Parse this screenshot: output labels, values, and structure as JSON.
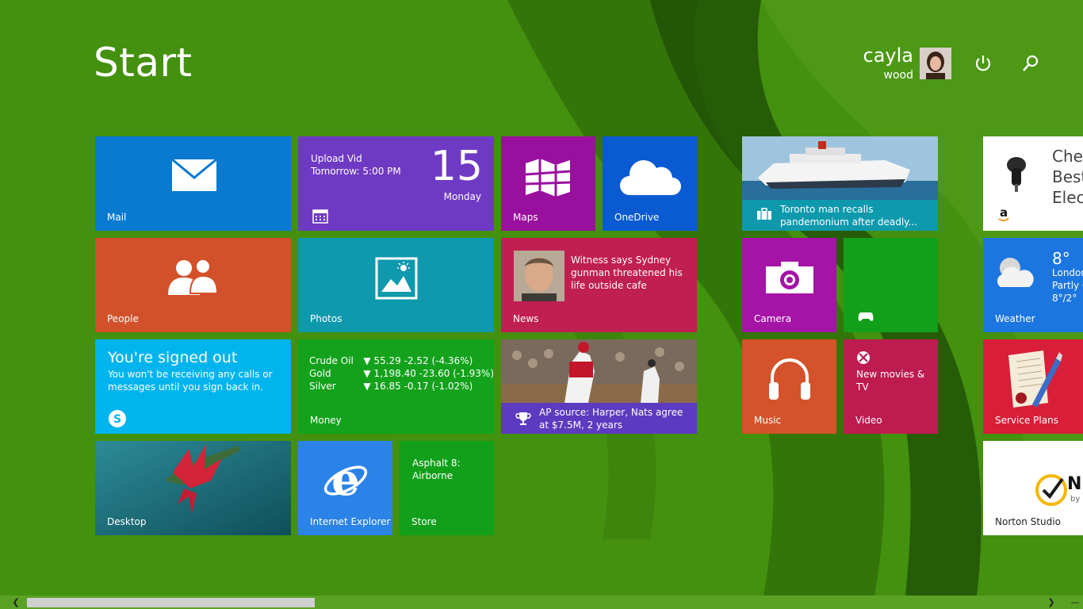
{
  "header": {
    "title": "Start",
    "user_first": "cayla",
    "user_last": "wood"
  },
  "tiles": {
    "mail": {
      "label": "Mail"
    },
    "calendar": {
      "event": "Upload Vid",
      "time": "Tomorrow: 5:00 PM",
      "day_num": "15",
      "day_name": "Monday"
    },
    "maps": {
      "label": "Maps"
    },
    "onedrive": {
      "label": "OneDrive"
    },
    "travel": {
      "headline": "Toronto man recalls pandemonium after deadly..."
    },
    "store_ad": {
      "text_line1": "Chec",
      "text_line2": "Best",
      "text_line3": "Elect"
    },
    "people": {
      "label": "People"
    },
    "photos": {
      "label": "Photos"
    },
    "news": {
      "headline": "Witness says Sydney gunman threatened his life outside cafe",
      "label": "News"
    },
    "camera": {
      "label": "Camera"
    },
    "weather": {
      "temp": "8°",
      "city": "London",
      "cond": "Partly C",
      "range": "8°/2°",
      "label": "Weather"
    },
    "skype": {
      "heading": "You're signed out",
      "body": "You won't be receiving any calls or messages until you sign back in."
    },
    "money": {
      "label": "Money",
      "rows": [
        {
          "name": "Crude Oil",
          "value": "▼ 55.29 -2.52 (-4.36%)"
        },
        {
          "name": "Gold",
          "value": "▼ 1,198.40 -23.60 (-1.93%)"
        },
        {
          "name": "Silver",
          "value": "▼ 16.85 -0.17 (-1.02%)"
        }
      ]
    },
    "sports": {
      "headline": "AP source: Harper, Nats agree at $7.5M, 2 years"
    },
    "music": {
      "label": "Music"
    },
    "video": {
      "promo": "New movies & TV",
      "label": "Video"
    },
    "service_plans": {
      "label": "Service Plans"
    },
    "desktop": {
      "label": "Desktop"
    },
    "ie": {
      "label": "Internet Explorer"
    },
    "store": {
      "game": "Asphalt 8: Airborne",
      "label": "Store"
    },
    "norton": {
      "label": "Norton Studio",
      "badge": "N",
      "badge_sub": "by"
    }
  },
  "colors": {
    "background": "#3f8a0e",
    "mail": "#0a7ad1",
    "calendar": "#6f3ac3",
    "maps": "#9a109e",
    "onedrive": "#0a5ad1",
    "people": "#d2512a",
    "photos": "#0e99ad",
    "news": "#c01f52",
    "camera": "#a414a6",
    "xbox": "#12a01a",
    "weather": "#1c76e0",
    "skype": "#00b4ee",
    "money": "#14a21c",
    "sports": "#5d3bc0",
    "music": "#d4532a",
    "video": "#be1b50",
    "service": "#d81e38",
    "ie": "#2b83e8",
    "store": "#12a01a"
  }
}
